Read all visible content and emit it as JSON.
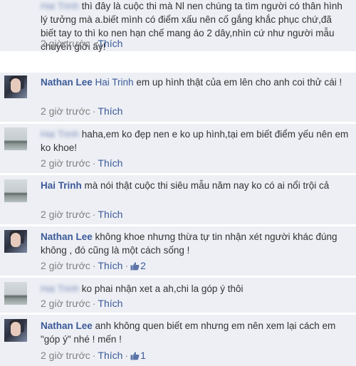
{
  "comments": [
    {
      "author": "Hai Trinh",
      "author_blurred": true,
      "text": "thì đây là cuộc thi mà Nl nen chúng ta tìm người có thân hình lý tưởng mà a.biết mình có điểm xấu nên cố gắng khắc phục chứ,đã biết tay to thì ko nen hạn chế mang áo 2 dây,nhìn cứ như người mẫu chuyển giới ấy!",
      "time": "2 giờ trước",
      "like_label": "Thích"
    },
    {
      "author": "Nathan Lee",
      "mention": "Hai Trinh",
      "text": "em up hình thật của em lên cho anh coi thử cái !",
      "time": "2 giờ trước",
      "like_label": "Thích"
    },
    {
      "author": "Hai Trinh",
      "author_blurred": true,
      "text": "haha,em ko đẹp nen e ko up hình,tại em biết điểm yếu nên em ko khoe!",
      "time": "2 giờ trước",
      "like_label": "Thích"
    },
    {
      "author": "Hai Trinh",
      "text": "mà nói thật cuộc thi siêu mẫu năm nay ko có ai nổi trội cả",
      "time": "2 giờ trước",
      "like_label": "Thích"
    },
    {
      "author": "Nathan Lee",
      "text": "không khoe nhưng thừa tự tin nhận xét người khác đúng không , đó cũng là một cách sống !",
      "time": "2 giờ trước",
      "like_label": "Thích",
      "likes": "2"
    },
    {
      "author": "Hai Trinh",
      "author_blurred": true,
      "text": "ko phai nhận xet a ah,chi la góp ý thôi",
      "time": "2 giờ trước",
      "like_label": "Thích"
    },
    {
      "author": "Nathan Lee",
      "text": "anh không quen biết em nhưng em nên xem lại cách em \"góp ý\" nhé ! mến !",
      "time": "2 giờ trước",
      "like_label": "Thích",
      "likes": "1"
    }
  ],
  "meta_separator": "·",
  "colors": {
    "background": "#edeff4",
    "link": "#3b5998",
    "meta": "#808080"
  },
  "icons": {
    "thumb": "thumbs-up-icon"
  }
}
